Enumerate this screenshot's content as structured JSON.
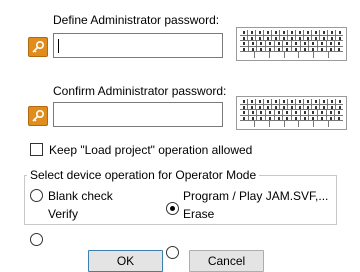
{
  "dialog": {
    "define_password": {
      "label": "Define Administrator password:",
      "value": ""
    },
    "confirm_password": {
      "label": "Confirm Administrator password:",
      "value": ""
    },
    "keep_load_project": {
      "label": "Keep \"Load project\" operation allowed",
      "checked": false
    },
    "device_operation": {
      "title": "Select device operation for Operator Mode",
      "options": [
        {
          "label": "Blank check",
          "selected": false
        },
        {
          "label": "Program / Play JAM.SVF,...",
          "selected": true
        },
        {
          "label": "Verify",
          "selected": false
        },
        {
          "label": "Erase",
          "selected": false
        }
      ]
    },
    "buttons": {
      "ok": "OK",
      "cancel": "Cancel"
    }
  },
  "icons": {
    "key_icon": "key-icon",
    "keyboard_icon": "virtual-keyboard-icon",
    "key_color": "#e08d1e"
  }
}
